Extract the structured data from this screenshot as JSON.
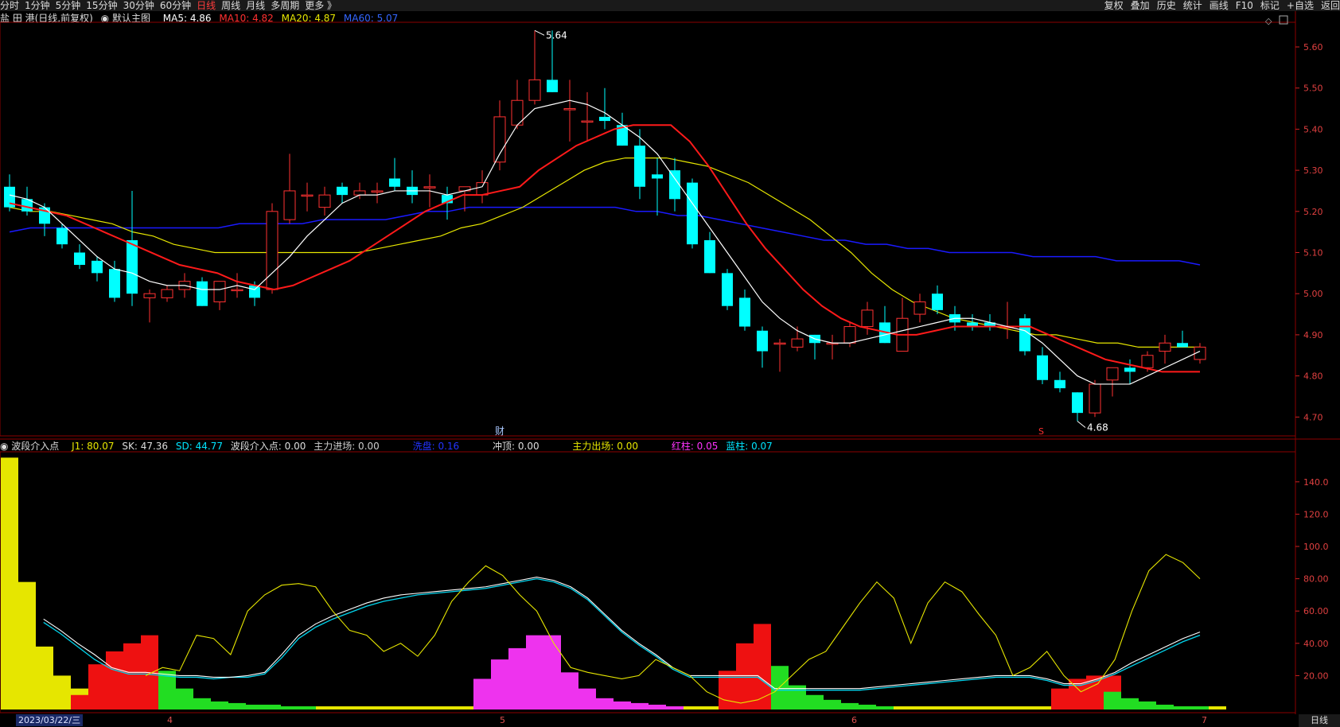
{
  "toolbar": {
    "tabs": [
      "分时",
      "1分钟",
      "5分钟",
      "15分钟",
      "30分钟",
      "60分钟",
      "日线",
      "周线",
      "月线",
      "多周期",
      "更多 》"
    ],
    "active_tab": "日线",
    "right_buttons": [
      "复权",
      "叠加",
      "历史",
      "统计",
      "画线",
      "F10",
      "标记",
      "+自选",
      "返回"
    ]
  },
  "main_info": {
    "stock": "盐 田 港(日线,前复权)",
    "template": "默认主图",
    "ma5": "MA5: 4.86",
    "ma10": "MA10: 4.82",
    "ma20": "MA20: 4.87",
    "ma60": "MA60: 5.07"
  },
  "sub_info": {
    "name": "波段介入点",
    "j1": "J1: 80.07",
    "sk": "SK: 47.36",
    "sd": "SD: 44.77",
    "entry": "波段介入点: 0.00",
    "inflow": "主力进场: 0.00",
    "wash": "洗盘: 0.16",
    "peak": "冲顶: 0.00",
    "outflow": "主力出场: 0.00",
    "red_bar": "红柱: 0.05",
    "blue_bar": "蓝柱: 0.07"
  },
  "markers": {
    "cai": "财",
    "s": "S",
    "high": "5.64",
    "low": "4.68"
  },
  "axis": {
    "date": "2023/03/22/三",
    "months": [
      "4",
      "5",
      "6",
      "7"
    ],
    "period": "日线",
    "price_ticks": [
      "5.60",
      "5.50",
      "5.40",
      "5.30",
      "5.20",
      "5.10",
      "5.00",
      "4.90",
      "4.80",
      "4.70"
    ],
    "osc_ticks": [
      "140.0",
      "120.0",
      "100.0",
      "80.00",
      "60.00",
      "40.00",
      "20.00"
    ]
  },
  "colors": {
    "up": "#ff3232",
    "down": "#00ffff",
    "ma5": "#ffffff",
    "ma10": "#ff1a1a",
    "ma20": "#e6e600",
    "ma60": "#1a1aff",
    "ma60_label": "#3366ff"
  },
  "chart_data": {
    "type": "candlestick",
    "ohlc": [
      [
        5.26,
        5.29,
        5.2,
        5.21
      ],
      [
        5.23,
        5.26,
        5.19,
        5.2
      ],
      [
        5.21,
        5.22,
        5.14,
        5.17
      ],
      [
        5.16,
        5.17,
        5.11,
        5.12
      ],
      [
        5.1,
        5.12,
        5.06,
        5.07
      ],
      [
        5.08,
        5.09,
        5.03,
        5.05
      ],
      [
        5.06,
        5.08,
        4.98,
        4.99
      ],
      [
        5.13,
        5.25,
        4.97,
        5.0
      ],
      [
        4.99,
        5.01,
        4.93,
        5.0
      ],
      [
        4.99,
        5.02,
        4.98,
        5.01
      ],
      [
        5.01,
        5.05,
        4.99,
        5.03
      ],
      [
        5.03,
        5.04,
        4.97,
        4.97
      ],
      [
        4.98,
        5.02,
        4.96,
        5.03
      ],
      [
        5.01,
        5.05,
        4.99,
        5.01
      ],
      [
        5.02,
        5.03,
        4.97,
        4.99
      ],
      [
        5.01,
        5.22,
        5.0,
        5.2
      ],
      [
        5.18,
        5.34,
        5.17,
        5.25
      ],
      [
        5.24,
        5.27,
        5.2,
        5.24
      ],
      [
        5.21,
        5.26,
        5.19,
        5.24
      ],
      [
        5.26,
        5.27,
        5.22,
        5.24
      ],
      [
        5.24,
        5.27,
        5.23,
        5.25
      ],
      [
        5.25,
        5.27,
        5.22,
        5.25
      ],
      [
        5.28,
        5.33,
        5.25,
        5.26
      ],
      [
        5.26,
        5.3,
        5.22,
        5.24
      ],
      [
        5.26,
        5.29,
        5.21,
        5.26
      ],
      [
        5.24,
        5.26,
        5.18,
        5.22
      ],
      [
        5.25,
        5.26,
        5.2,
        5.26
      ],
      [
        5.24,
        5.3,
        5.22,
        5.27
      ],
      [
        5.32,
        5.47,
        5.3,
        5.43
      ],
      [
        5.41,
        5.52,
        5.4,
        5.47
      ],
      [
        5.47,
        5.64,
        5.46,
        5.52
      ],
      [
        5.52,
        5.64,
        5.49,
        5.49
      ],
      [
        5.45,
        5.52,
        5.37,
        5.45
      ],
      [
        5.42,
        5.49,
        5.37,
        5.42
      ],
      [
        5.43,
        5.5,
        5.4,
        5.42
      ],
      [
        5.41,
        5.44,
        5.36,
        5.36
      ],
      [
        5.36,
        5.4,
        5.23,
        5.26
      ],
      [
        5.29,
        5.33,
        5.19,
        5.28
      ],
      [
        5.3,
        5.33,
        5.2,
        5.23
      ],
      [
        5.27,
        5.28,
        5.11,
        5.12
      ],
      [
        5.13,
        5.15,
        5.05,
        5.05
      ],
      [
        5.05,
        5.06,
        4.96,
        4.97
      ],
      [
        4.99,
        5.01,
        4.91,
        4.92
      ],
      [
        4.91,
        4.92,
        4.82,
        4.86
      ],
      [
        4.88,
        4.89,
        4.81,
        4.88
      ],
      [
        4.87,
        4.92,
        4.86,
        4.89
      ],
      [
        4.9,
        4.9,
        4.84,
        4.88
      ],
      [
        4.88,
        4.9,
        4.84,
        4.88
      ],
      [
        4.88,
        4.93,
        4.87,
        4.92
      ],
      [
        4.92,
        4.98,
        4.9,
        4.96
      ],
      [
        4.93,
        4.97,
        4.88,
        4.88
      ],
      [
        4.86,
        4.99,
        4.86,
        4.94
      ],
      [
        4.95,
        5.0,
        4.93,
        4.98
      ],
      [
        5.0,
        5.02,
        4.95,
        4.96
      ],
      [
        4.95,
        4.97,
        4.91,
        4.93
      ],
      [
        4.93,
        4.95,
        4.91,
        4.92
      ],
      [
        4.93,
        4.95,
        4.91,
        4.92
      ],
      [
        4.92,
        4.98,
        4.89,
        4.92
      ],
      [
        4.94,
        4.95,
        4.85,
        4.86
      ],
      [
        4.85,
        4.87,
        4.78,
        4.79
      ],
      [
        4.79,
        4.81,
        4.76,
        4.77
      ],
      [
        4.76,
        4.76,
        4.69,
        4.71
      ],
      [
        4.71,
        4.79,
        4.7,
        4.78
      ],
      [
        4.79,
        4.82,
        4.75,
        4.82
      ],
      [
        4.82,
        4.84,
        4.78,
        4.81
      ],
      [
        4.82,
        4.86,
        4.81,
        4.85
      ],
      [
        4.86,
        4.9,
        4.83,
        4.88
      ],
      [
        4.88,
        4.91,
        4.87,
        4.87
      ],
      [
        4.84,
        4.88,
        4.83,
        4.87
      ]
    ],
    "ma5": [
      5.24,
      5.23,
      5.21,
      5.17,
      5.13,
      5.09,
      5.06,
      5.05,
      5.03,
      5.02,
      5.02,
      5.01,
      5.01,
      5.02,
      5.01,
      5.05,
      5.09,
      5.14,
      5.18,
      5.22,
      5.24,
      5.24,
      5.25,
      5.25,
      5.25,
      5.24,
      5.25,
      5.26,
      5.34,
      5.41,
      5.45,
      5.46,
      5.47,
      5.46,
      5.44,
      5.41,
      5.38,
      5.34,
      5.28,
      5.22,
      5.16,
      5.1,
      5.04,
      4.98,
      4.94,
      4.91,
      4.89,
      4.88,
      4.88,
      4.89,
      4.9,
      4.91,
      4.92,
      4.93,
      4.94,
      4.94,
      4.93,
      4.92,
      4.91,
      4.88,
      4.84,
      4.8,
      4.78,
      4.78,
      4.78,
      4.8,
      4.82,
      4.84,
      4.86
    ],
    "ma10": [
      5.22,
      5.21,
      5.2,
      5.19,
      5.17,
      5.15,
      5.13,
      5.11,
      5.09,
      5.07,
      5.06,
      5.05,
      5.03,
      5.02,
      5.01,
      5.02,
      5.04,
      5.06,
      5.08,
      5.11,
      5.14,
      5.17,
      5.2,
      5.22,
      5.24,
      5.24,
      5.25,
      5.26,
      5.3,
      5.33,
      5.36,
      5.38,
      5.4,
      5.41,
      5.41,
      5.41,
      5.37,
      5.31,
      5.24,
      5.17,
      5.11,
      5.06,
      5.01,
      4.97,
      4.94,
      4.92,
      4.91,
      4.9,
      4.9,
      4.91,
      4.92,
      4.92,
      4.92,
      4.92,
      4.92,
      4.9,
      4.88,
      4.86,
      4.84,
      4.83,
      4.82,
      4.81,
      4.81,
      4.81
    ],
    "ma20": [
      5.21,
      5.2,
      5.2,
      5.19,
      5.18,
      5.17,
      5.15,
      5.14,
      5.12,
      5.11,
      5.1,
      5.1,
      5.1,
      5.1,
      5.1,
      5.1,
      5.1,
      5.1,
      5.11,
      5.12,
      5.13,
      5.14,
      5.16,
      5.17,
      5.19,
      5.21,
      5.24,
      5.27,
      5.3,
      5.32,
      5.33,
      5.33,
      5.33,
      5.32,
      5.31,
      5.29,
      5.27,
      5.24,
      5.21,
      5.18,
      5.14,
      5.1,
      5.05,
      5.01,
      4.98,
      4.96,
      4.94,
      4.93,
      4.92,
      4.91,
      4.9,
      4.9,
      4.89,
      4.88,
      4.88,
      4.87,
      4.87,
      4.87,
      4.87
    ],
    "ma60": [
      5.15,
      5.16,
      5.16,
      5.16,
      5.16,
      5.16,
      5.16,
      5.16,
      5.16,
      5.16,
      5.16,
      5.17,
      5.17,
      5.17,
      5.17,
      5.18,
      5.18,
      5.18,
      5.18,
      5.19,
      5.2,
      5.2,
      5.21,
      5.21,
      5.21,
      5.21,
      5.21,
      5.21,
      5.21,
      5.21,
      5.2,
      5.2,
      5.19,
      5.19,
      5.18,
      5.17,
      5.16,
      5.15,
      5.14,
      5.13,
      5.13,
      5.12,
      5.12,
      5.11,
      5.11,
      5.1,
      5.1,
      5.1,
      5.1,
      5.09,
      5.09,
      5.09,
      5.09,
      5.08,
      5.08,
      5.08,
      5.08,
      5.07
    ],
    "osc": {
      "j1": [
        null,
        null,
        null,
        null,
        null,
        null,
        null,
        null,
        20,
        25,
        23,
        45,
        43,
        33,
        60,
        70,
        76,
        77,
        75,
        60,
        48,
        45,
        35,
        40,
        32,
        45,
        66,
        78,
        88,
        82,
        70,
        60,
        40,
        25,
        22,
        20,
        18,
        20,
        30,
        25,
        20,
        10,
        5,
        3,
        5,
        10,
        20,
        30,
        35,
        50,
        65,
        78,
        68,
        40,
        65,
        78,
        72,
        58,
        45,
        20,
        25,
        35,
        20,
        10,
        15,
        30,
        60,
        85,
        95,
        90,
        80
      ],
      "sk": [
        null,
        null,
        55,
        48,
        40,
        33,
        25,
        22,
        22,
        21,
        20,
        20,
        19,
        19,
        20,
        22,
        33,
        45,
        52,
        57,
        61,
        65,
        68,
        70,
        71,
        72,
        73,
        74,
        75,
        77,
        79,
        81,
        79,
        75,
        68,
        58,
        48,
        40,
        33,
        25,
        20,
        20,
        20,
        20,
        20,
        12,
        12,
        12,
        12,
        12,
        12,
        13,
        14,
        15,
        16,
        17,
        18,
        19,
        20,
        20,
        20,
        18,
        15,
        15,
        18,
        22,
        28,
        33,
        38,
        43,
        47
      ],
      "sd": [
        null,
        null,
        53,
        46,
        38,
        30,
        24,
        21,
        21,
        20,
        19,
        19,
        18,
        19,
        19,
        21,
        31,
        43,
        50,
        55,
        59,
        63,
        66,
        68,
        70,
        71,
        72,
        73,
        74,
        76,
        78,
        80,
        78,
        74,
        67,
        57,
        47,
        39,
        32,
        24,
        19,
        19,
        19,
        19,
        19,
        11,
        11,
        11,
        11,
        11,
        11,
        12,
        13,
        14,
        15,
        16,
        17,
        18,
        19,
        19,
        19,
        17,
        14,
        14,
        17,
        21,
        26,
        31,
        36,
        41,
        45
      ],
      "white_step": [
        null,
        null,
        null,
        null,
        null,
        null,
        null,
        null,
        null,
        null,
        null,
        null,
        null,
        null,
        null,
        null,
        null,
        null,
        null,
        null,
        null,
        null,
        null,
        null,
        null,
        null,
        null,
        null,
        null,
        null,
        null,
        null,
        null,
        null,
        null,
        null,
        null,
        null,
        null,
        null,
        null,
        20,
        20,
        20,
        20,
        20,
        20,
        20,
        20,
        null,
        null,
        null,
        null,
        null,
        null,
        null,
        null,
        null,
        null,
        null,
        null,
        null,
        20,
        20,
        20,
        null,
        null,
        null,
        null,
        null,
        null
      ]
    },
    "osc_bars": [
      {
        "s": 0,
        "h": [
          155,
          78,
          38,
          20,
          12,
          8,
          5,
          3,
          2,
          2,
          1,
          1,
          1,
          1,
          1,
          1,
          1,
          1,
          1,
          1,
          1,
          1,
          1,
          1,
          1,
          1,
          1,
          1,
          1,
          1,
          1,
          1,
          1,
          1,
          1,
          1,
          1,
          1,
          1,
          1,
          1,
          1,
          1,
          1,
          1,
          1,
          1,
          1,
          1,
          1,
          1,
          1,
          1,
          1,
          1,
          1,
          1,
          1,
          1,
          1,
          1,
          1,
          1,
          1,
          1,
          1,
          1,
          1,
          1,
          1
        ],
        "c": "yellow"
      },
      {
        "s": 4,
        "h": [
          8,
          27,
          35,
          40,
          45
        ],
        "c": "red"
      },
      {
        "s": 9,
        "h": [
          23,
          12,
          6,
          4,
          3,
          2,
          2,
          1,
          1
        ],
        "c": "green"
      },
      {
        "s": 27,
        "h": [
          18,
          30,
          37,
          45,
          45,
          22,
          12,
          6,
          4,
          3,
          2,
          1
        ],
        "c": "magenta"
      },
      {
        "s": 41,
        "h": [
          23,
          40,
          52
        ],
        "c": "red"
      },
      {
        "s": 44,
        "h": [
          26,
          14,
          8,
          5,
          3,
          2,
          1
        ],
        "c": "green"
      },
      {
        "s": 60,
        "h": [
          12,
          18,
          20,
          20
        ],
        "c": "red"
      },
      {
        "s": 63,
        "h": [
          10,
          6,
          4,
          2,
          1,
          1
        ],
        "c": "green"
      }
    ]
  }
}
